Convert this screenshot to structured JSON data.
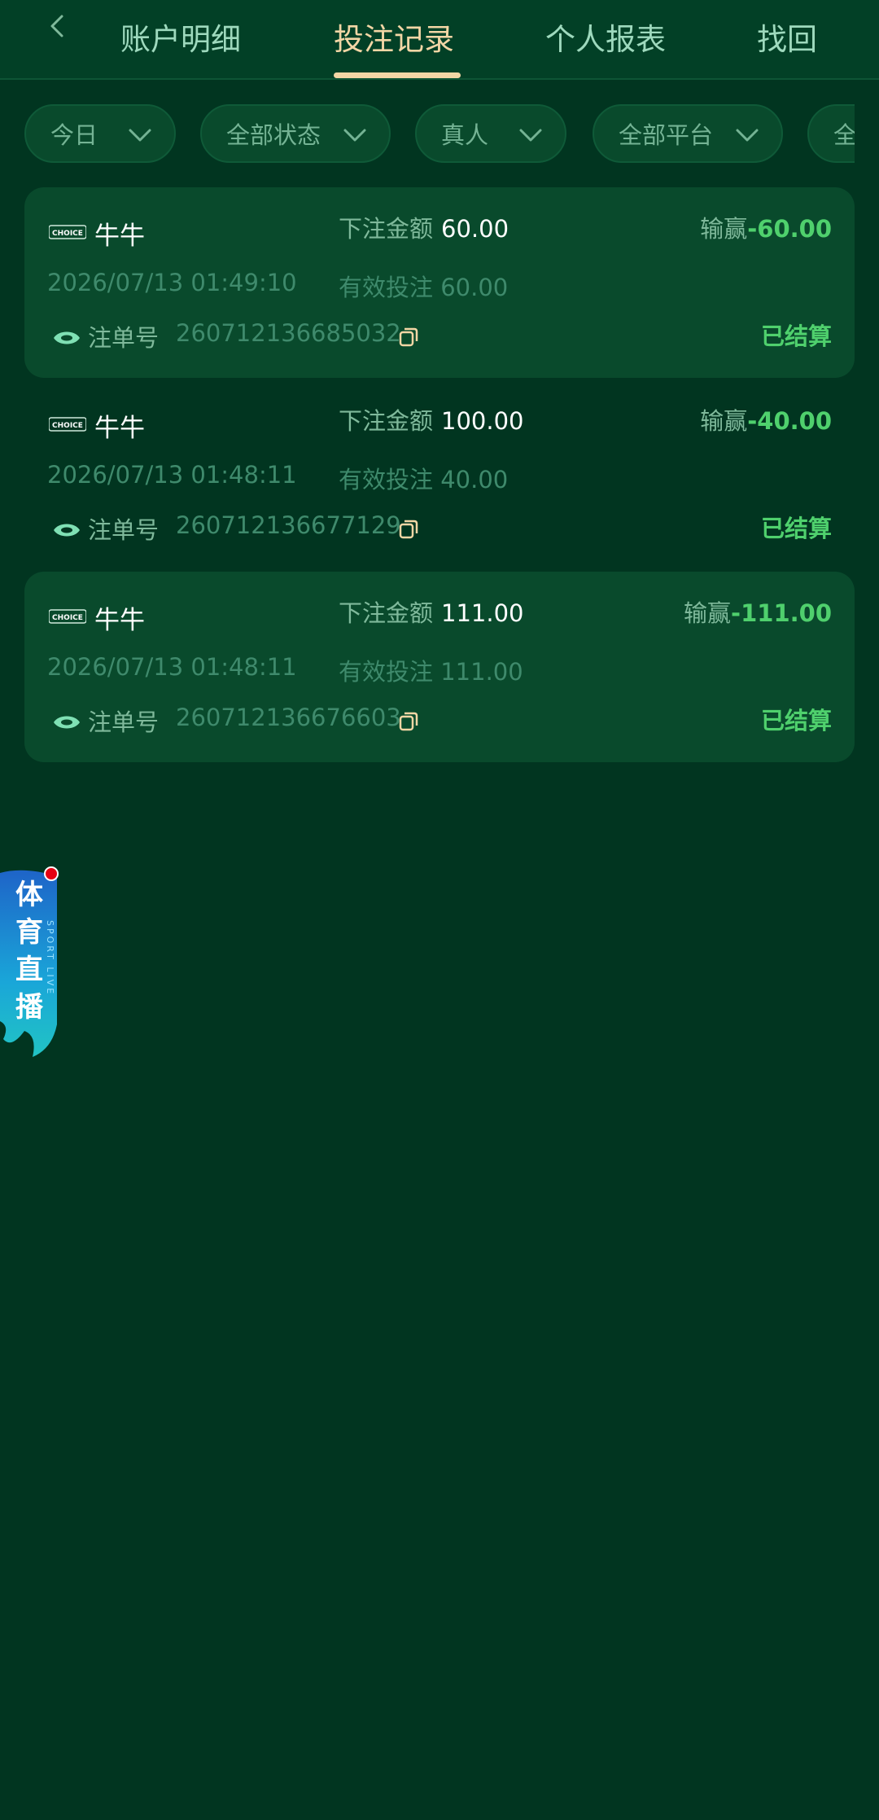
{
  "tabs": [
    {
      "label": "账户明细",
      "active": false
    },
    {
      "label": "投注记录",
      "active": true
    },
    {
      "label": "个人报表",
      "active": false
    },
    {
      "label": "找回",
      "active": false
    }
  ],
  "filters": [
    {
      "label": "今日"
    },
    {
      "label": "全部状态"
    },
    {
      "label": "真人"
    },
    {
      "label": "全部平台"
    },
    {
      "label": "全"
    }
  ],
  "records_labels": {
    "bet_amount": "下注金额",
    "win_loss": "输赢",
    "valid_bet": "有效投注",
    "order_no": "注单号"
  },
  "records": [
    {
      "game": "牛牛",
      "logo_text": "CHOICE",
      "bet_amount": "60.00",
      "win_loss": "-60.00",
      "date": "2026/07/13 01:49:10",
      "valid_bet": "60.00",
      "order_no": "260712136685032",
      "status": "已结算"
    },
    {
      "game": "牛牛",
      "logo_text": "CHOICE",
      "bet_amount": "100.00",
      "win_loss": "-40.00",
      "date": "2026/07/13 01:48:11",
      "valid_bet": "40.00",
      "order_no": "260712136677129",
      "status": "已结算"
    },
    {
      "game": "牛牛",
      "logo_text": "CHOICE",
      "bet_amount": "111.00",
      "win_loss": "-111.00",
      "date": "2026/07/13 01:48:11",
      "valid_bet": "111.00",
      "order_no": "260712136676603",
      "status": "已结算"
    }
  ],
  "live_badge": {
    "title": "体育直播",
    "subtitle": "SPORT LIVE"
  },
  "colors": {
    "background": "#013520",
    "card": "#094a2c",
    "accent_gold": "#f2d6a5",
    "win_green": "#4fd06d"
  },
  "icons": [
    "back-arrow-icon",
    "chevron-down-icon",
    "eye-icon",
    "copy-icon"
  ]
}
